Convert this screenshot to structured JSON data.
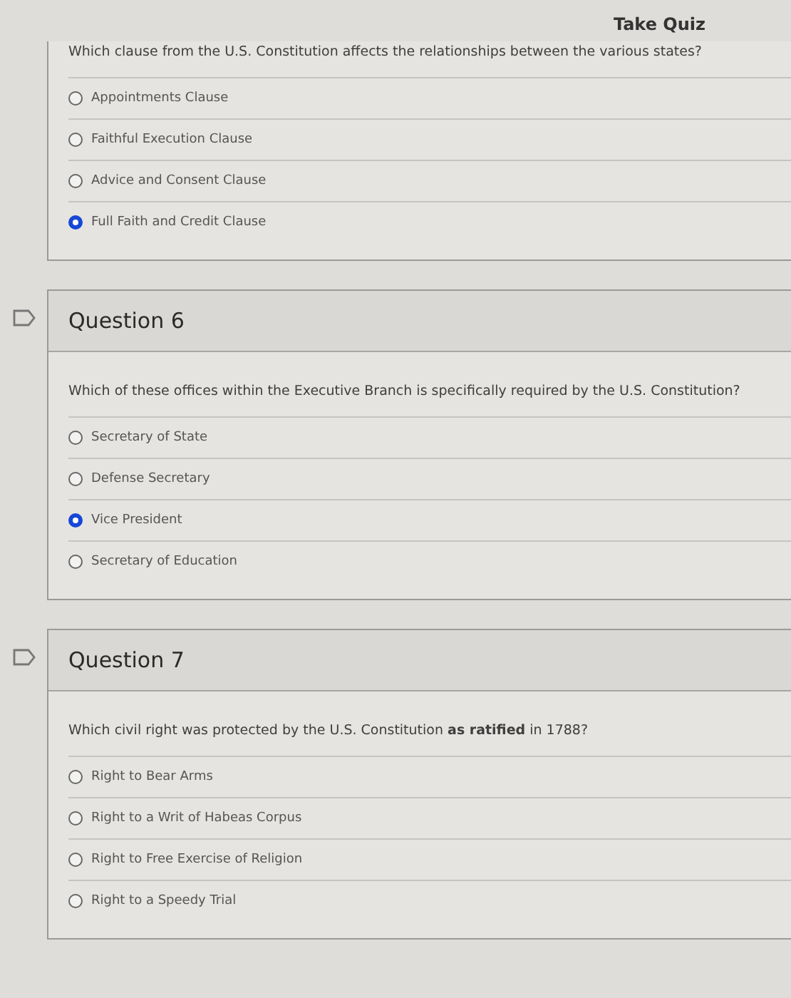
{
  "header": {
    "title": "Take Quiz"
  },
  "questions": [
    {
      "text": "Which clause from the U.S. Constitution affects the relationships between the various states?",
      "answers": [
        {
          "label": "Appointments Clause",
          "selected": false
        },
        {
          "label": "Faithful Execution Clause",
          "selected": false
        },
        {
          "label": "Advice and Consent Clause",
          "selected": false
        },
        {
          "label": "Full Faith and Credit Clause",
          "selected": true
        }
      ]
    },
    {
      "flagged": true,
      "title": "Question 6",
      "text": "Which of these offices within the Executive Branch is specifically required by the U.S. Constitution?",
      "answers": [
        {
          "label": "Secretary of State",
          "selected": false
        },
        {
          "label": "Defense Secretary",
          "selected": false
        },
        {
          "label": "Vice President",
          "selected": true
        },
        {
          "label": "Secretary of Education",
          "selected": false
        }
      ]
    },
    {
      "flagged": true,
      "title": "Question 7",
      "text": "Which civil right was protected by the U.S. Constitution **as ratified** in 1788?",
      "answers": [
        {
          "label": "Right to Bear Arms",
          "selected": false
        },
        {
          "label": "Right to a Writ of Habeas Corpus",
          "selected": false
        },
        {
          "label": "Right to Free Exercise of Religion",
          "selected": false
        },
        {
          "label": "Right to a Speedy Trial",
          "selected": false
        }
      ]
    }
  ]
}
